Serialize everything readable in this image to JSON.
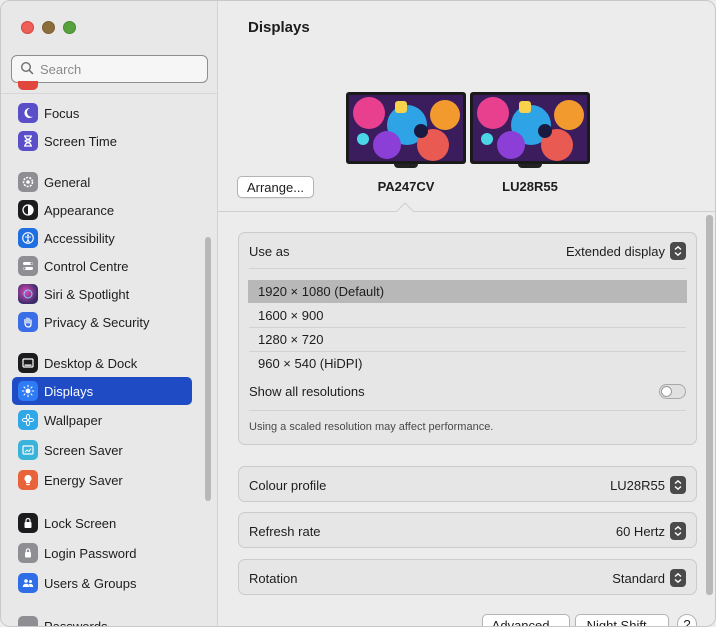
{
  "window": {
    "title": "Displays"
  },
  "search": {
    "placeholder": "Search"
  },
  "sidebar": {
    "items": [
      {
        "label": "Focus",
        "icon": "moon-icon",
        "color": "#5a4ec9"
      },
      {
        "label": "Screen Time",
        "icon": "hourglass-icon",
        "color": "#5a4ec9"
      },
      {
        "label": "General",
        "icon": "gear-icon",
        "color": "#8e8e93"
      },
      {
        "label": "Appearance",
        "icon": "appearance-icon",
        "color": "#1c1c1e"
      },
      {
        "label": "Accessibility",
        "icon": "accessibility-icon",
        "color": "#1f6fe0"
      },
      {
        "label": "Control Centre",
        "icon": "control-centre-icon",
        "color": "#8e8e93"
      },
      {
        "label": "Siri & Spotlight",
        "icon": "siri-icon",
        "color": "#3a2b6b"
      },
      {
        "label": "Privacy & Security",
        "icon": "hand-icon",
        "color": "#3a6ee6"
      },
      {
        "label": "Desktop & Dock",
        "icon": "dock-icon",
        "color": "#1c1c1e"
      },
      {
        "label": "Displays",
        "icon": "sun-icon",
        "color": "#2f7bf6"
      },
      {
        "label": "Wallpaper",
        "icon": "flower-icon",
        "color": "#30a7e6"
      },
      {
        "label": "Screen Saver",
        "icon": "screensaver-icon",
        "color": "#39b3d9"
      },
      {
        "label": "Energy Saver",
        "icon": "bulb-icon",
        "color": "#e8623a"
      },
      {
        "label": "Lock Screen",
        "icon": "lock-icon",
        "color": "#1c1c1e"
      },
      {
        "label": "Login Password",
        "icon": "key-icon",
        "color": "#8e8e93"
      },
      {
        "label": "Users & Groups",
        "icon": "users-icon",
        "color": "#2f6ee6"
      },
      {
        "label": "Passwords",
        "icon": "passwords-icon",
        "color": "#8e8e93"
      }
    ]
  },
  "displays": {
    "arrange_label": "Arrange...",
    "monitors": [
      {
        "name": "PA247CV"
      },
      {
        "name": "LU28R55"
      }
    ]
  },
  "use_as": {
    "label": "Use as",
    "value": "Extended display"
  },
  "resolutions": [
    "1920 × 1080 (Default)",
    "1600 × 900",
    "1280 × 720",
    "960 × 540 (HiDPI)"
  ],
  "show_all": {
    "label": "Show all resolutions",
    "enabled": false
  },
  "note": "Using a scaled resolution may affect performance.",
  "colour_profile": {
    "label": "Colour profile",
    "value": "LU28R55"
  },
  "refresh_rate": {
    "label": "Refresh rate",
    "value": "60 Hertz"
  },
  "rotation": {
    "label": "Rotation",
    "value": "Standard"
  },
  "footer": {
    "advanced_label": "Advanced...",
    "night_shift_label": "Night Shift...",
    "help_label": "?"
  },
  "colors": {
    "accent": "#1f4bc4"
  }
}
